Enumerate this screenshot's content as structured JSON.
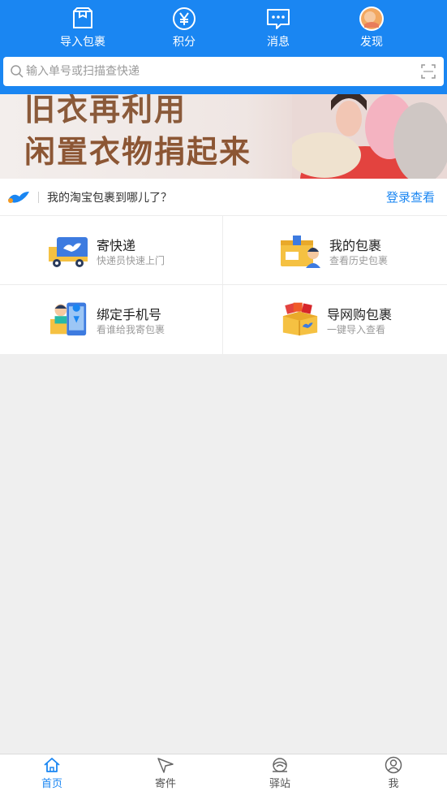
{
  "top_nav": [
    {
      "label": "导入包裹",
      "icon": "import-package-icon"
    },
    {
      "label": "积分",
      "icon": "points-yen-icon"
    },
    {
      "label": "消息",
      "icon": "message-icon"
    },
    {
      "label": "发现",
      "icon": "discover-avatar-icon"
    }
  ],
  "search": {
    "placeholder": "输入单号或扫描查快递"
  },
  "banner": {
    "line1": "旧衣再利用",
    "line2": "闲置衣物捐起来",
    "dots": 2,
    "active_dot": 2
  },
  "query_bar": {
    "text": "我的淘宝包裹到哪儿了？",
    "link": "登录查看"
  },
  "grid": [
    {
      "title": "寄快递",
      "subtitle": "快递员快速上门",
      "icon": "delivery-truck-icon"
    },
    {
      "title": "我的包裹",
      "subtitle": "查看历史包裹",
      "icon": "my-package-icon"
    },
    {
      "title": "绑定手机号",
      "subtitle": "看谁给我寄包裹",
      "icon": "bind-phone-icon"
    },
    {
      "title": "导网购包裹",
      "subtitle": "一键导入查看",
      "icon": "online-shopping-box-icon"
    }
  ],
  "tabbar": [
    {
      "label": "首页",
      "icon": "home-icon",
      "active": true
    },
    {
      "label": "寄件",
      "icon": "send-icon",
      "active": false
    },
    {
      "label": "驿站",
      "icon": "station-icon",
      "active": false
    },
    {
      "label": "我",
      "icon": "profile-icon",
      "active": false
    }
  ],
  "colors": {
    "primary": "#1a86f2",
    "background": "#efefef"
  }
}
